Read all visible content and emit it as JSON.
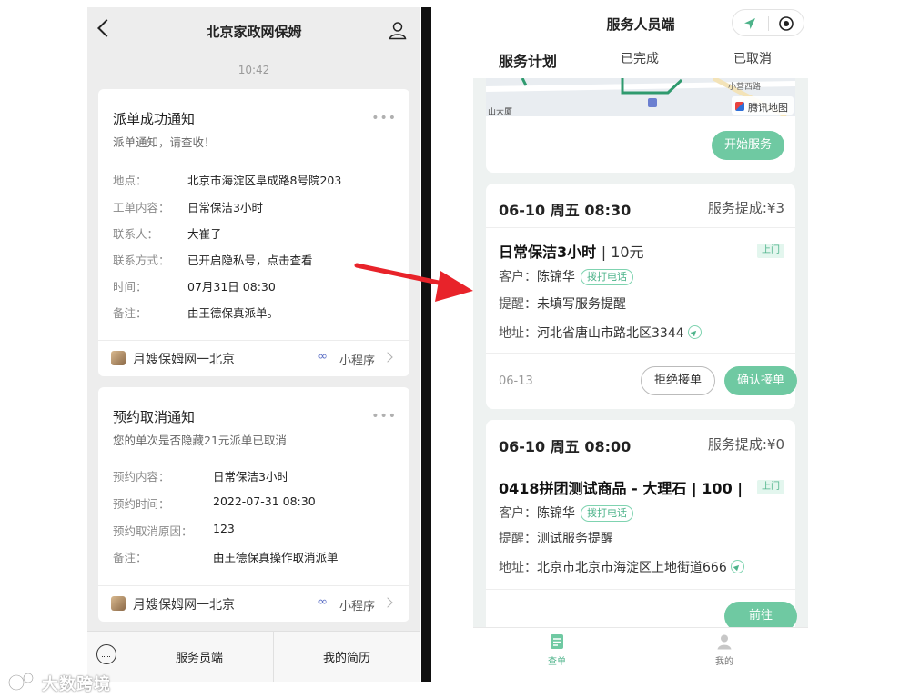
{
  "left_chat": {
    "title": "北京家政网保姆",
    "time": "10:42",
    "dispatch_card": {
      "title": "派单成功通知",
      "subtitle": "派单通知，请查收！",
      "more": "•••",
      "fields": [
        {
          "label": "地点：",
          "value": "北京市海淀区阜成路8号院203"
        },
        {
          "label": "工单内容：",
          "value": "日常保洁3小时"
        },
        {
          "label": "联系人：",
          "value": "大崔子"
        },
        {
          "label": "联系方式：",
          "value": "已开启隐私号，点击查看"
        },
        {
          "label": "时间：",
          "value": "07月31日 08:30"
        },
        {
          "label": "备注：",
          "value": "由王德保真派单。"
        }
      ],
      "footer_name": "月嫂保姆网一北京",
      "footer_link": "小程序"
    },
    "cancel_card": {
      "title": "预约取消通知",
      "subtitle": "您的单次是否隐藏21元派单已取消",
      "more": "•••",
      "fields": [
        {
          "label": "预约内容：",
          "value": "日常保洁3小时"
        },
        {
          "label": "预约时间：",
          "value": "2022-07-31 08:30"
        },
        {
          "label": "预约取消原因：",
          "value": "123"
        },
        {
          "label": "备注：",
          "value": "由王德保真操作取消派单"
        }
      ],
      "footer_name": "月嫂保姆网一北京",
      "footer_link": "小程序"
    },
    "bottom_menu": [
      "服务员端",
      "我的简历"
    ]
  },
  "right_app": {
    "title": "服务人员端",
    "tabs": [
      "服务计划",
      "已完成",
      "已取消"
    ],
    "active_tab": "服务计划",
    "map_labels": {
      "provider": "腾讯地图",
      "road": "小营西路",
      "place": "山大厦"
    },
    "start_button": "开始服务",
    "orders": [
      {
        "datetime": "06-10 周五 08:30",
        "commission": "服务提成:¥3",
        "product": "日常保洁3小时",
        "price": "| 10元",
        "tag": "上门",
        "customer_label": "客户：",
        "customer": "陈锦华",
        "call": "拨打电话",
        "reminder_label": "提醒：",
        "reminder": "未填写服务提醒",
        "address_label": "地址：",
        "address": "河北省唐山市路北区3344",
        "date": "06-13",
        "reject_button": "拒绝接单",
        "confirm_button": "确认接单"
      },
      {
        "datetime": "06-10 周五 08:00",
        "commission": "服务提成:¥0",
        "product": "0418拼团测试商品 - 大理石 | 100 |",
        "price": "",
        "tag": "上门",
        "customer_label": "客户：",
        "customer": "陈锦华",
        "call": "拨打电话",
        "reminder_label": "提醒：",
        "reminder": "测试服务提醒",
        "address_label": "地址：",
        "address": "北京市北京市海淀区上地街道666",
        "go_button": "前往"
      }
    ],
    "bottom_nav": [
      {
        "label": "查单",
        "icon": "order-icon",
        "active": true
      },
      {
        "label": "我的",
        "icon": "profile-icon",
        "active": false
      }
    ],
    "accent_color": "#6fc9a2"
  },
  "watermark": "大数跨境",
  "arrow_color": "#e8232a"
}
